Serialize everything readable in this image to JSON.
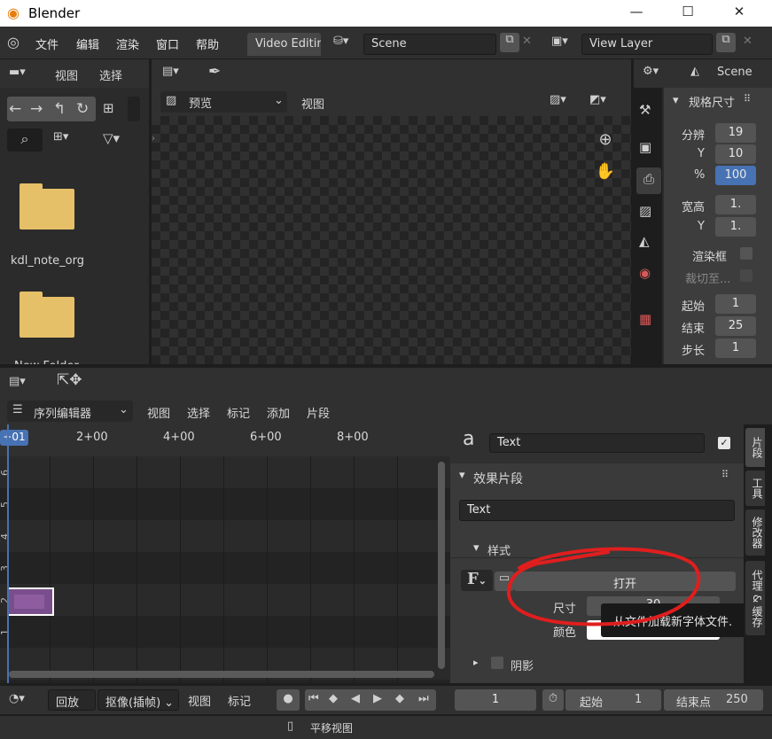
{
  "window": {
    "title": "Blender",
    "min_icon": "minimize-icon",
    "max_icon": "maximize-icon",
    "close_icon": "close-icon"
  },
  "menu": {
    "items": [
      "文件",
      "编辑",
      "渲染",
      "窗口",
      "帮助"
    ],
    "workspace_tab": "Video Editing",
    "scene": "Scene",
    "view_layer": "View Layer"
  },
  "file_browser": {
    "view": "视图",
    "select": "选择",
    "items": [
      "kdl_note_org",
      "New Folder"
    ]
  },
  "preview": {
    "mode": "预览",
    "view": "视图"
  },
  "properties": {
    "scene_label": "Scene",
    "panel_title": "规格尺寸",
    "res_x_label": "分辨",
    "res_x": "19",
    "res_y_label": "Y",
    "res_y": "10",
    "pct_label": "%",
    "pct": "100",
    "aspect_label": "宽高",
    "aspect_x": "1.",
    "aspect_y_label": "Y",
    "aspect_y": "1.",
    "render_region": "渲染框",
    "crop": "裁切至...",
    "start_label": "起始",
    "start": "1",
    "end_label": "结束",
    "end": "25",
    "step_label": "步长",
    "step": "1"
  },
  "sequencer": {
    "editor": "序列编辑器",
    "menus": [
      "视图",
      "选择",
      "标记",
      "添加",
      "片段"
    ],
    "current_frame": "+01",
    "ruler": [
      "2+00",
      "4+00",
      "6+00",
      "8+00"
    ],
    "channels": [
      "6",
      "5",
      "4",
      "3",
      "2",
      "1"
    ],
    "strip_color": "#7a4e8c"
  },
  "sidebar": {
    "strip_name": "Text",
    "effect_panel": "效果片段",
    "text_value": "Text",
    "style_label": "样式",
    "open_button": "打开",
    "size_label": "尺寸",
    "size_value": "30",
    "color_label": "颜色",
    "tooltip": "从文件加载新字体文件.",
    "shadow_label": "阴影",
    "tabs": [
      "片段",
      "工具",
      "修改器",
      "代理 & 缓存"
    ]
  },
  "timeline": {
    "playback": "回放",
    "keying": "抠像(插帧)",
    "view": "视图",
    "marker": "标记",
    "frame": "1",
    "start_label": "起始",
    "start": "1",
    "end_label": "结束点",
    "end": "250"
  },
  "status": {
    "text": "平移视图"
  },
  "colors": {
    "accent": "#4772b3",
    "annotation": "#e01e1e"
  }
}
